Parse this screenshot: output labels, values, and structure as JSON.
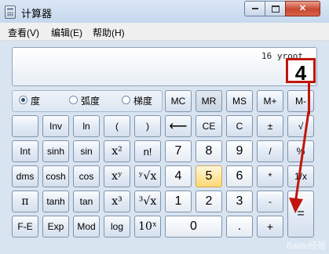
{
  "window": {
    "title": "计算器",
    "min_icon": "minimize-icon",
    "max_icon": "maximize-icon",
    "close_label": "✕"
  },
  "menu": {
    "view": "查看(V)",
    "edit": "编辑(E)",
    "help": "帮助(H)"
  },
  "display": {
    "expression": "16 yroot",
    "result": "4"
  },
  "angle_modes": {
    "degrees": "度",
    "radians": "弧度",
    "grads": "梯度",
    "selected": "度"
  },
  "keys": {
    "mc": "MC",
    "mr": "MR",
    "ms": "MS",
    "mplus": "M+",
    "mminus": "M-",
    "inv": "Inv",
    "ln": "ln",
    "lparen": "(",
    "rparen": ")",
    "backspace": "⟵",
    "ce": "CE",
    "c": "C",
    "plusminus": "±",
    "sqrt": "√",
    "int": "Int",
    "sinh": "sinh",
    "sin": "sin",
    "square": "x²",
    "factorial": "n!",
    "seven": "7",
    "eight": "8",
    "nine": "9",
    "divide": "/",
    "percent": "%",
    "dms": "dms",
    "cosh": "cosh",
    "cos": "cos",
    "xpowy": "xʸ",
    "yroot": "ʸ√x",
    "four": "4",
    "five": "5",
    "six": "6",
    "multiply": "*",
    "reciprocal": "1/x",
    "pi": "π",
    "tanh": "tanh",
    "tan": "tan",
    "cube": "x³",
    "cuberoot": "³√x",
    "one": "1",
    "two": "2",
    "three": "3",
    "minus": "-",
    "equals": "=",
    "fe": "F-E",
    "exp": "Exp",
    "mod": "Mod",
    "log": "log",
    "tenpow": "10ˣ",
    "zero": "0",
    "decimal": ".",
    "plus": "+"
  },
  "watermark": "Baidu经验",
  "colors": {
    "annotation": "#c0160c",
    "highlight_key": "#fbd874"
  }
}
